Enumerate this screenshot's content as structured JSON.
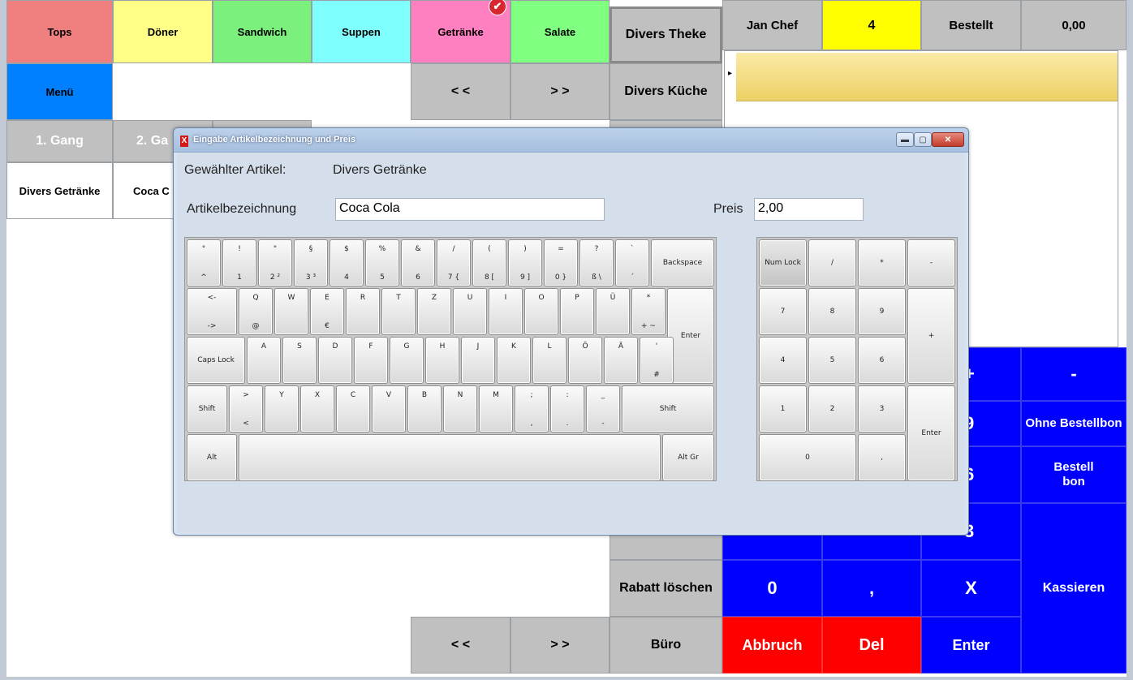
{
  "categories": [
    {
      "label": "Tops",
      "color": "#f08080"
    },
    {
      "label": "Döner",
      "color": "#ffff88"
    },
    {
      "label": "Sandwich",
      "color": "#7cf07c"
    },
    {
      "label": "Suppen",
      "color": "#80ffff"
    },
    {
      "label": "Getränke",
      "color": "#ff80c0"
    },
    {
      "label": "Salate",
      "color": "#80ff80"
    }
  ],
  "menu_label": "Menü",
  "menu_color": "#0080ff",
  "nav": {
    "prev": "< <",
    "next": "> >"
  },
  "divers": {
    "theke": "Divers Theke",
    "kueche": "Divers Küche",
    "rabatt": "Rabatt löschen",
    "buero": "Büro"
  },
  "gang": {
    "first": "1. Gang",
    "second": "2. Ga"
  },
  "articles": {
    "a1": "Divers Getränke",
    "a2": "Coca C"
  },
  "header": {
    "waiter": "Jan Chef",
    "table": "4",
    "status": "Bestellt",
    "amount": "0,00"
  },
  "pad": {
    "plus": "+",
    "minus": "-",
    "nine": "9",
    "six": "6",
    "three": "3",
    "zero": "0",
    "comma": ",",
    "x": "X",
    "ohne": "Ohne Bestellbon",
    "bestell": "Bestell bon",
    "kassieren": "Kassieren",
    "abbruch": "Abbruch",
    "del": "Del",
    "enter": "Enter"
  },
  "dialog": {
    "title": "Eingabe Artikelbezeichnung und Preis",
    "selected_label": "Gewählter Artikel:",
    "selected_value": "Divers Getränke",
    "name_label": "Artikelbezeichnung",
    "name_value": "Coca Cola",
    "price_label": "Preis",
    "price_value": "2,00"
  },
  "keyboard": {
    "row1": [
      [
        "°",
        "^"
      ],
      [
        "!",
        "1"
      ],
      [
        "\"",
        "2 ²"
      ],
      [
        "§",
        "3 ³"
      ],
      [
        "$",
        "4"
      ],
      [
        "%",
        "5"
      ],
      [
        "&",
        "6"
      ],
      [
        "/",
        "7 {"
      ],
      [
        "(",
        "8 ["
      ],
      [
        ")",
        "9 ]"
      ],
      [
        "=",
        "0 }"
      ],
      [
        "?",
        "ß \\"
      ],
      [
        "`",
        "´"
      ]
    ],
    "backspace": "Backspace",
    "tab_top": "<-",
    "tab_bottom": "->",
    "row2": [
      [
        "Q",
        "@"
      ],
      [
        "W",
        ""
      ],
      [
        "E",
        "€"
      ],
      [
        "R",
        ""
      ],
      [
        "T",
        ""
      ],
      [
        "Z",
        ""
      ],
      [
        "U",
        ""
      ],
      [
        "I",
        ""
      ],
      [
        "O",
        ""
      ],
      [
        "P",
        ""
      ],
      [
        "Ü",
        ""
      ],
      [
        "*",
        "+ ~"
      ]
    ],
    "enter": "Enter",
    "caps": "Caps Lock",
    "row3": [
      [
        "A",
        ""
      ],
      [
        "S",
        ""
      ],
      [
        "D",
        ""
      ],
      [
        "F",
        ""
      ],
      [
        "G",
        ""
      ],
      [
        "H",
        ""
      ],
      [
        "J",
        ""
      ],
      [
        "K",
        ""
      ],
      [
        "L",
        ""
      ],
      [
        "Ö",
        ""
      ],
      [
        "Ä",
        ""
      ],
      [
        "'",
        "#"
      ]
    ],
    "shift": "Shift",
    "row4": [
      [
        ">",
        "<"
      ],
      [
        "Y",
        ""
      ],
      [
        "X",
        ""
      ],
      [
        "C",
        ""
      ],
      [
        "V",
        ""
      ],
      [
        "B",
        ""
      ],
      [
        "N",
        ""
      ],
      [
        "M",
        ""
      ],
      [
        ";",
        ","
      ],
      [
        ":",
        "."
      ],
      [
        "_",
        "-"
      ]
    ],
    "alt": "Alt",
    "altgr": "Alt Gr"
  },
  "numpad": {
    "numlock": "Num Lock",
    "slash": "/",
    "star": "*",
    "minus": "-",
    "n7": "7",
    "n8": "8",
    "n9": "9",
    "plus": "+",
    "n4": "4",
    "n5": "5",
    "n6": "6",
    "n1": "1",
    "n2": "2",
    "n3": "3",
    "enter": "Enter",
    "n0": "0",
    "comma": ","
  }
}
